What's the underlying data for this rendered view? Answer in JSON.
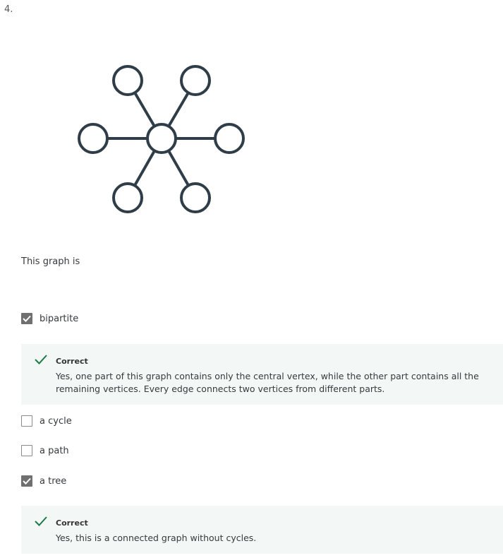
{
  "question": {
    "number": "4.",
    "prompt": "This graph is"
  },
  "options": [
    {
      "label": "bipartite",
      "checked": true,
      "feedback": {
        "status": "Correct",
        "text": "Yes, one part of this graph contains only the central vertex, while the other part contains all the remaining vertices. Every edge connects two vertices from different parts."
      }
    },
    {
      "label": "a cycle",
      "checked": false
    },
    {
      "label": "a path",
      "checked": false
    },
    {
      "label": "a tree",
      "checked": true,
      "feedback": {
        "status": "Correct",
        "text": "Yes, this is a connected graph without cycles."
      }
    }
  ],
  "colors": {
    "graph_stroke": "#2e3d47",
    "checkbox_checked": "#707070",
    "feedback_bg": "#f3f8f6",
    "correct_check": "#1e7a46"
  }
}
